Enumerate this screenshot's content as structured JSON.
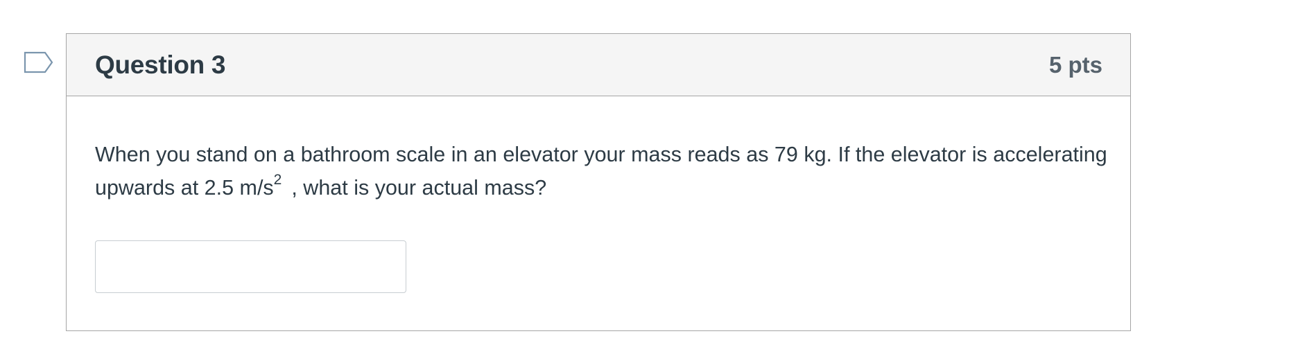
{
  "question": {
    "title": "Question 3",
    "points": "5 pts",
    "text_part1": "When you stand on a bathroom scale in an elevator your mass reads as 79 kg. If the elevator is accelerating upwards at 2.5 m/s",
    "text_superscript": "2",
    "text_part2": ", what is your actual mass?",
    "answer": {
      "value": "",
      "placeholder": ""
    }
  },
  "flag": {
    "icon": "bookmark-flag-icon",
    "color": "#7a95ad"
  },
  "colors": {
    "header_bg": "#f5f5f5",
    "border": "#a5a5a5",
    "text": "#2d3b45",
    "points_text": "#56626c"
  }
}
